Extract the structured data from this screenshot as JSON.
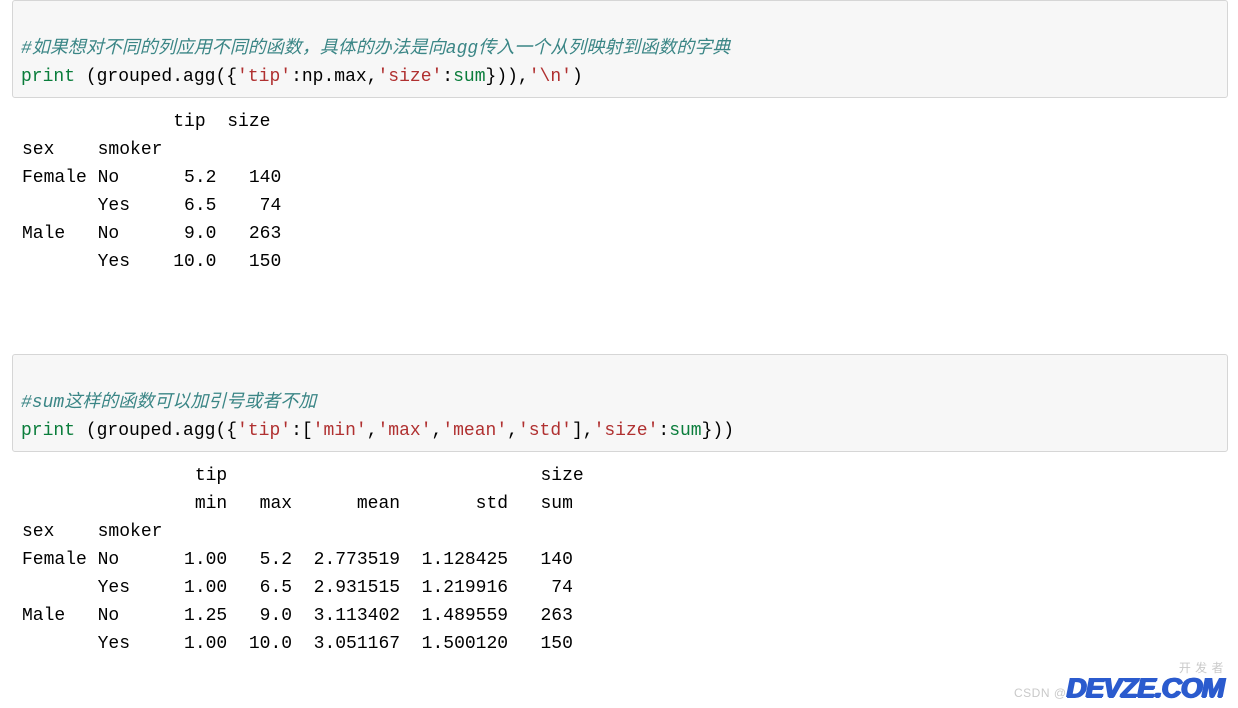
{
  "cell1": {
    "comment": "#如果想对不同的列应用不同的函数，具体的办法是向agg传入一个从列映射到函数的字典",
    "code_tokens": {
      "print": "print",
      "open": " (grouped.agg({",
      "s_tip": "'tip'",
      "colon1": ":np.max,",
      "s_size": "'size'",
      "colon2": ":",
      "sum": "sum",
      "close": "})),",
      "nl": "'\\n'",
      "end": ")"
    },
    "output": "              tip  size\nsex    smoker           \nFemale No      5.2   140\n       Yes     6.5    74\nMale   No      9.0   263\n       Yes    10.0   150"
  },
  "cell2": {
    "comment": "#sum这样的函数可以加引号或者不加",
    "code_tokens": {
      "print": "print",
      "open": " (grouped.agg({",
      "s_tip": "'tip'",
      "colon1": ":[",
      "s_min": "'min'",
      "c1": ",",
      "s_max": "'max'",
      "c2": ",",
      "s_mean": "'mean'",
      "c3": ",",
      "s_std": "'std'",
      "cb": "],",
      "s_size": "'size'",
      "colon2": ":",
      "sum": "sum",
      "end": "}))"
    },
    "output": "                tip                             size\n                min   max      mean       std   sum\nsex    smoker                                      \nFemale No      1.00   5.2  2.773519  1.128425   140\n       Yes     1.00   6.5  2.931515  1.219916    74\nMale   No      1.25   9.0  3.113402  1.489559   263\n       Yes     1.00  10.0  3.051167  1.500120   150"
  },
  "watermark": {
    "top_line1": "开 发 者",
    "csdn": "CSDN @",
    "logo": "DEVZE.COM"
  },
  "chart_data": [
    {
      "type": "table",
      "title": "grouped.agg({'tip':np.max,'size':sum})",
      "columns": [
        "sex",
        "smoker",
        "tip",
        "size"
      ],
      "rows": [
        [
          "Female",
          "No",
          5.2,
          140
        ],
        [
          "Female",
          "Yes",
          6.5,
          74
        ],
        [
          "Male",
          "No",
          9.0,
          263
        ],
        [
          "Male",
          "Yes",
          10.0,
          150
        ]
      ]
    },
    {
      "type": "table",
      "title": "grouped.agg({'tip':['min','max','mean','std'],'size':sum})",
      "columns": [
        "sex",
        "smoker",
        "tip.min",
        "tip.max",
        "tip.mean",
        "tip.std",
        "size.sum"
      ],
      "rows": [
        [
          "Female",
          "No",
          1.0,
          5.2,
          2.773519,
          1.128425,
          140
        ],
        [
          "Female",
          "Yes",
          1.0,
          6.5,
          2.931515,
          1.219916,
          74
        ],
        [
          "Male",
          "No",
          1.25,
          9.0,
          3.113402,
          1.489559,
          263
        ],
        [
          "Male",
          "Yes",
          1.0,
          10.0,
          3.051167,
          1.50012,
          150
        ]
      ]
    }
  ]
}
